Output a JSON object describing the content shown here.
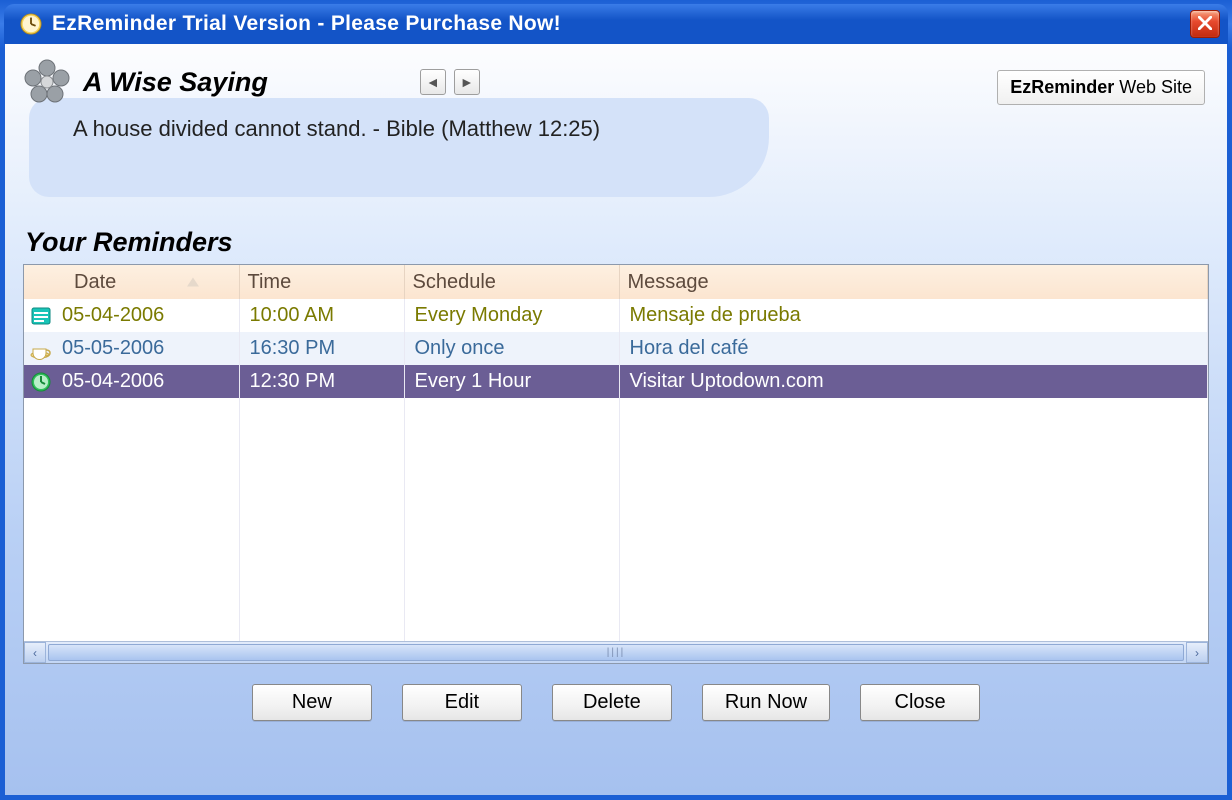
{
  "window": {
    "title": "EzReminder Trial Version  - Please Purchase Now!"
  },
  "saying": {
    "heading": "A Wise Saying",
    "text": "A house divided cannot stand. - Bible (Matthew 12:25)"
  },
  "website_link": {
    "brand": "EzReminder",
    "suffix": " Web Site"
  },
  "reminders": {
    "heading": "Your Reminders",
    "columns": {
      "date": "Date",
      "time": "Time",
      "schedule": "Schedule",
      "message": "Message"
    },
    "rows": [
      {
        "date": "05-04-2006",
        "time": "10:00 AM",
        "schedule": "Every Monday",
        "message": "Mensaje de prueba",
        "icon": "calendar-icon"
      },
      {
        "date": "05-05-2006",
        "time": "16:30 PM",
        "schedule": "Only once",
        "message": "Hora del café",
        "icon": "coffee-icon"
      },
      {
        "date": "05-04-2006",
        "time": "12:30 PM",
        "schedule": "Every 1 Hour",
        "message": "Visitar Uptodown.com",
        "icon": "clock-icon"
      }
    ],
    "selected_index": 2
  },
  "buttons": {
    "new_": "New",
    "edit": "Edit",
    "delete_": "Delete",
    "run_now": "Run Now",
    "close": "Close"
  }
}
